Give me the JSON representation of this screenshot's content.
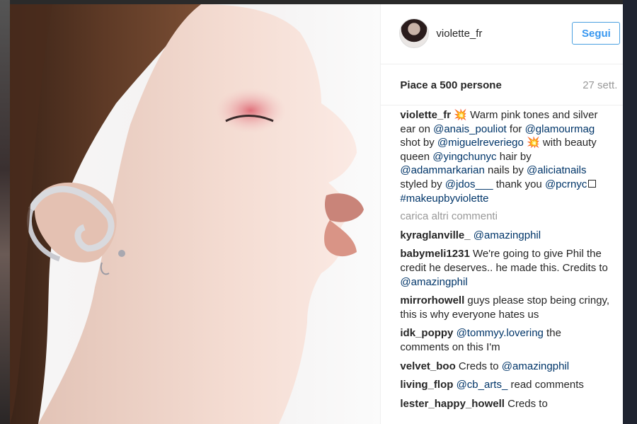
{
  "post": {
    "username": "violette_fr",
    "follow_label": "Segui",
    "likes": "Piace a 500 persone",
    "time": "27 sett."
  },
  "caption": {
    "user": "violette_fr",
    "parts": [
      {
        "t": "text",
        "v": " "
      },
      {
        "t": "emoji",
        "v": "💥"
      },
      {
        "t": "text",
        "v": " Warm pink tones and silver ear on "
      },
      {
        "t": "mention",
        "v": "@anais_pouliot"
      },
      {
        "t": "text",
        "v": " for "
      },
      {
        "t": "mention",
        "v": "@glamourmag"
      },
      {
        "t": "text",
        "v": " shot by "
      },
      {
        "t": "mention",
        "v": "@miguelreveriego"
      },
      {
        "t": "text",
        "v": " "
      },
      {
        "t": "emoji",
        "v": "💥"
      },
      {
        "t": "text",
        "v": " with beauty queen "
      },
      {
        "t": "mention",
        "v": "@yingchunyc"
      },
      {
        "t": "text",
        "v": " hair by "
      },
      {
        "t": "mention",
        "v": "@adammarkarian"
      },
      {
        "t": "text",
        "v": " nails by "
      },
      {
        "t": "mention",
        "v": "@aliciatnails"
      },
      {
        "t": "text",
        "v": " styled by "
      },
      {
        "t": "mention",
        "v": "@jdos___"
      },
      {
        "t": "text",
        "v": " thank you "
      },
      {
        "t": "mention",
        "v": "@pcrnyc"
      },
      {
        "t": "box",
        "v": ""
      },
      {
        "t": "text",
        "v": " "
      },
      {
        "t": "mention",
        "v": "#makeupbyviolette"
      }
    ]
  },
  "load_more": "carica altri commenti",
  "comments": [
    {
      "user": "kyraglanville_",
      "parts": [
        {
          "t": "text",
          "v": " "
        },
        {
          "t": "mention",
          "v": "@amazingphil"
        }
      ]
    },
    {
      "user": "babymeli1231",
      "parts": [
        {
          "t": "text",
          "v": " We're going to give Phil the credit he deserves.. he made this. Credits to "
        },
        {
          "t": "mention",
          "v": "@amazingphil"
        }
      ]
    },
    {
      "user": "mirrorhowell",
      "parts": [
        {
          "t": "text",
          "v": " guys please stop being cringy, this is why everyone hates us"
        }
      ]
    },
    {
      "user": "idk_poppy",
      "parts": [
        {
          "t": "text",
          "v": " "
        },
        {
          "t": "mention",
          "v": "@tommyy.lovering"
        },
        {
          "t": "text",
          "v": " the comments on this I'm"
        }
      ]
    },
    {
      "user": "velvet_boo",
      "parts": [
        {
          "t": "text",
          "v": " Creds to "
        },
        {
          "t": "mention",
          "v": "@amazingphil"
        }
      ]
    },
    {
      "user": "living_flop",
      "parts": [
        {
          "t": "text",
          "v": " "
        },
        {
          "t": "mention",
          "v": "@cb_arts_"
        },
        {
          "t": "text",
          "v": " read comments"
        }
      ]
    },
    {
      "user": "lester_happy_howell",
      "parts": [
        {
          "t": "text",
          "v": " Creds to"
        }
      ]
    }
  ],
  "colors": {
    "mention": "#003569",
    "follow": "#3897f0",
    "muted": "#999999"
  }
}
